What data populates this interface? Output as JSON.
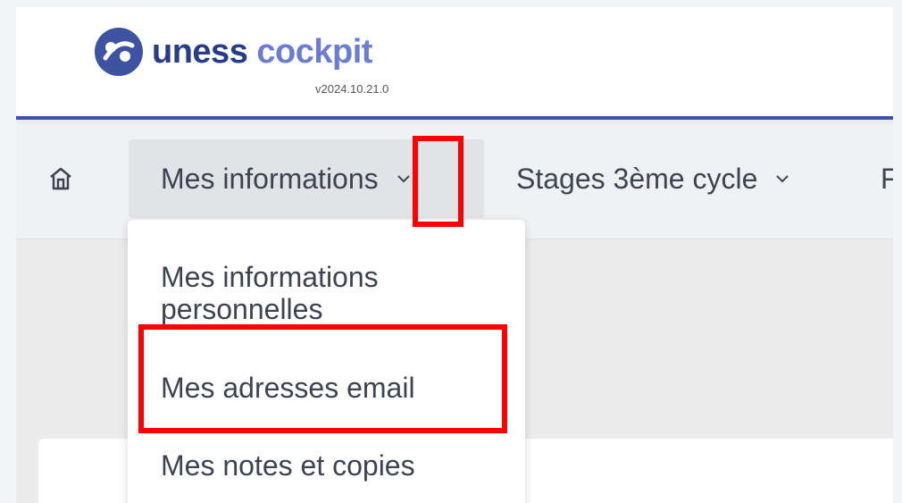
{
  "header": {
    "brand_part1": "uness",
    "brand_part2": "cockpit",
    "version": "v2024.10.21.0"
  },
  "nav": {
    "home_icon": "home-icon",
    "items": [
      {
        "label": "Mes informations",
        "icon": "chevron-down-icon",
        "active": true
      },
      {
        "label": "Stages 3ème cycle",
        "icon": "chevron-down-icon"
      },
      {
        "label": "F"
      }
    ]
  },
  "dropdown": {
    "items": [
      {
        "label": "Mes informations personnelles"
      },
      {
        "label": "Mes adresses email"
      },
      {
        "label": "Mes notes et copies"
      }
    ]
  },
  "colors": {
    "brand_dark": "#283c8a",
    "brand_light": "#6a7dd2",
    "accent_bar": "#3a54a5",
    "highlight": "#ff0000"
  }
}
